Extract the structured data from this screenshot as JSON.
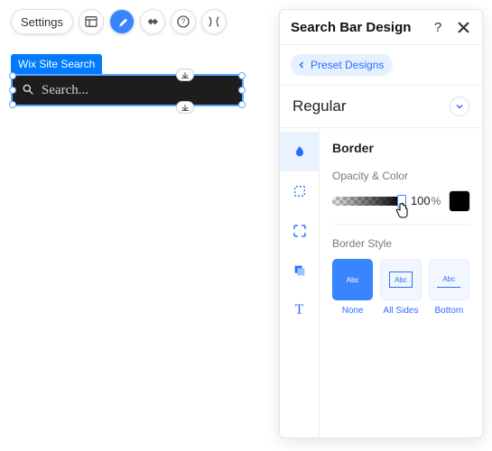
{
  "toolbar": {
    "settings_label": "Settings"
  },
  "component": {
    "type_label": "Wix Site Search",
    "placeholder": "Search..."
  },
  "panel": {
    "title": "Search Bar Design",
    "preset_label": "Preset Designs",
    "state_label": "Regular",
    "section_title": "Border",
    "opacity_label": "Opacity & Color",
    "opacity_value": "100",
    "opacity_unit": "%",
    "border_color": "#000000",
    "border_style_label": "Border Style",
    "styles": {
      "none": "None",
      "all": "All Sides",
      "bottom": "Bottom"
    },
    "abc": "Abc"
  }
}
